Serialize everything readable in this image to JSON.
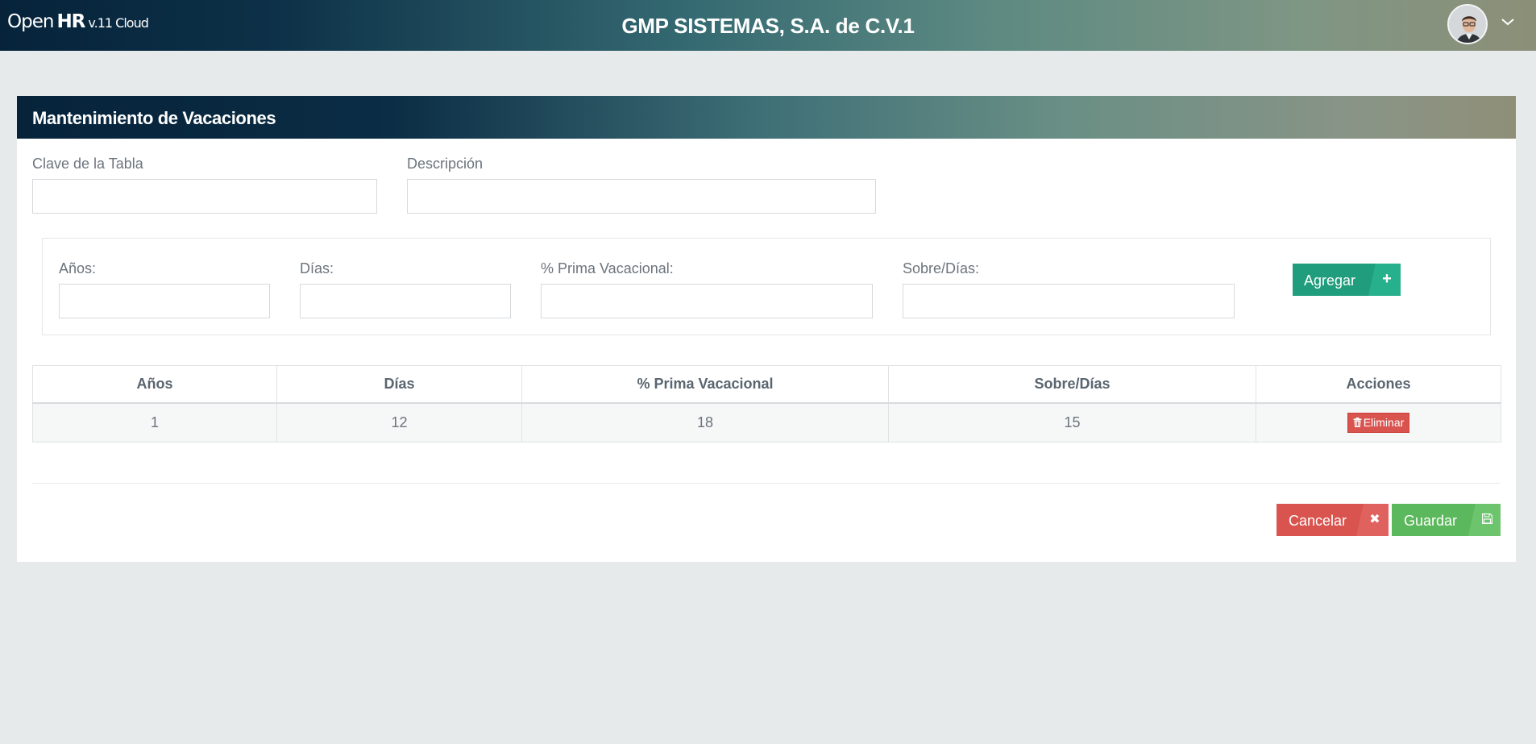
{
  "header": {
    "brand_open": "Open",
    "brand_hr": "HR",
    "brand_version": "v.11 Cloud",
    "company": "GMP SISTEMAS, S.A. de C.V.1"
  },
  "panel": {
    "title": "Mantenimiento de Vacaciones",
    "form": {
      "clave_label": "Clave de la Tabla",
      "clave_value": "",
      "descripcion_label": "Descripción",
      "descripcion_value": ""
    },
    "detail": {
      "anios_label": "Años:",
      "dias_label": "Días:",
      "prima_label": "% Prima Vacacional:",
      "sobre_label": "Sobre/Días:",
      "add_label": "Agregar"
    },
    "table": {
      "headers": [
        "Años",
        "Días",
        "% Prima Vacacional",
        "Sobre/Días",
        "Acciones"
      ],
      "rows": [
        {
          "anios": "1",
          "dias": "12",
          "prima": "18",
          "sobre": "15",
          "action": "Eliminar"
        }
      ]
    },
    "actions": {
      "cancel_label": "Cancelar",
      "save_label": "Guardar"
    }
  },
  "colors": {
    "add": "#1f9d7d",
    "danger": "#d9534f",
    "success": "#5cb85c",
    "header_dark": "#06233a"
  },
  "icons": {
    "add": "plus-icon",
    "delete": "trash-icon",
    "cancel": "close-icon",
    "save": "save-icon",
    "user_menu": "chevron-down-icon"
  }
}
